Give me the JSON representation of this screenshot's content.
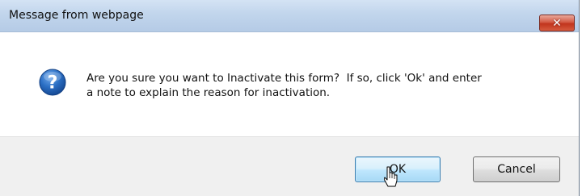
{
  "window": {
    "title": "Message from webpage",
    "close_glyph": "✕"
  },
  "message": {
    "line1": "Are you sure you want to Inactivate this form?  If so, click 'Ok' and enter",
    "line2": "a note to explain the reason for inactivation.",
    "icon": "question-icon"
  },
  "buttons": {
    "ok_label": "OK",
    "cancel_label": "Cancel"
  },
  "colors": {
    "icon_blue": "#1f63b8",
    "close_red": "#c1341d",
    "ok_border": "#3c7fb1"
  }
}
